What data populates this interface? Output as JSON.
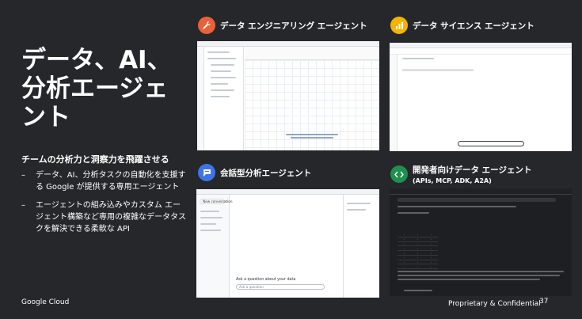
{
  "slide": {
    "title": "データ、AI、分析エージェント",
    "subtitle": "チームの分析力と洞察力を飛躍させる",
    "bullets": [
      "データ、AI、分析タスクの自動化を支援する Google が提供する専用エージェント",
      "エージェントの組み込みやカスタム エージェント構築など専用の複雑なデータタスクを解決できる柔軟な API"
    ],
    "footer_left": "Google Cloud",
    "footer_right": "Proprietary & Confidential",
    "page_number": "37"
  },
  "cards": [
    {
      "title": "データ エンジニアリング エージェント",
      "icon": "wrench-icon",
      "icon_color": "#e8613b"
    },
    {
      "title": "データ サイエンス エージェント",
      "icon": "chart-icon",
      "icon_color": "#f5b400"
    },
    {
      "title": "会話型分析エージェント",
      "icon": "chat-icon",
      "icon_color": "#3f74e6"
    },
    {
      "title": "開発者向けデータ エージェント",
      "subtitle": "(APIs, MCP, ADK, A2A)",
      "icon": "code-icon",
      "icon_color": "#1f8f4e"
    }
  ],
  "screenshots": {
    "conversational": {
      "new_conversation": "New conversation",
      "prompt": "Ask a question about your data",
      "input_placeholder": "Ask a question"
    }
  }
}
